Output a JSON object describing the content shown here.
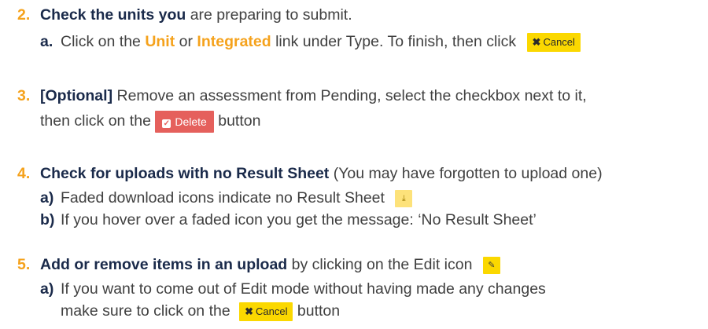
{
  "steps": [
    {
      "number": "2.",
      "heading": "Check the units you",
      "text": " are preparing to submit.",
      "subs": [
        {
          "label": "a.",
          "before": "Click on the ",
          "link1": "Unit",
          "mid": " or ",
          "link2": "Integrated",
          "after": " link under Type. To finish, then click",
          "button": "Cancel"
        }
      ]
    },
    {
      "number": "3.",
      "heading": "[Optional]",
      "text": " Remove an assessment from Pending, select the checkbox next to it,",
      "cont_before": "then click on the ",
      "button": "Delete",
      "cont_after": " button"
    },
    {
      "number": "4.",
      "heading": "Check for uploads with no Result Sheet",
      "text": " (You may have forgotten to upload one)",
      "subs": [
        {
          "label": "a)",
          "text": "Faded download icons indicate no Result Sheet"
        },
        {
          "label": "b)",
          "text": "If you hover over a faded icon you get the message: ‘No Result Sheet’"
        }
      ]
    },
    {
      "number": "5.",
      "heading": "Add or remove items in an upload",
      "text": " by clicking on the Edit icon",
      "subs": [
        {
          "label": "a)",
          "text": "If you want to  come out of Edit mode without having made any changes",
          "cont_before": "make sure to click on the ",
          "button": "Cancel",
          "cont_after": " button"
        }
      ]
    }
  ],
  "icons": {
    "cancel": "x-icon",
    "delete": "checkbox-icon",
    "download": "download-icon",
    "edit": "edit-icon"
  },
  "colors": {
    "number": "#f5a21c",
    "heading": "#1a2a4a",
    "cancel_button": "#fbd800",
    "delete_button": "#e5605c",
    "faded_icon": "#fde27a"
  }
}
